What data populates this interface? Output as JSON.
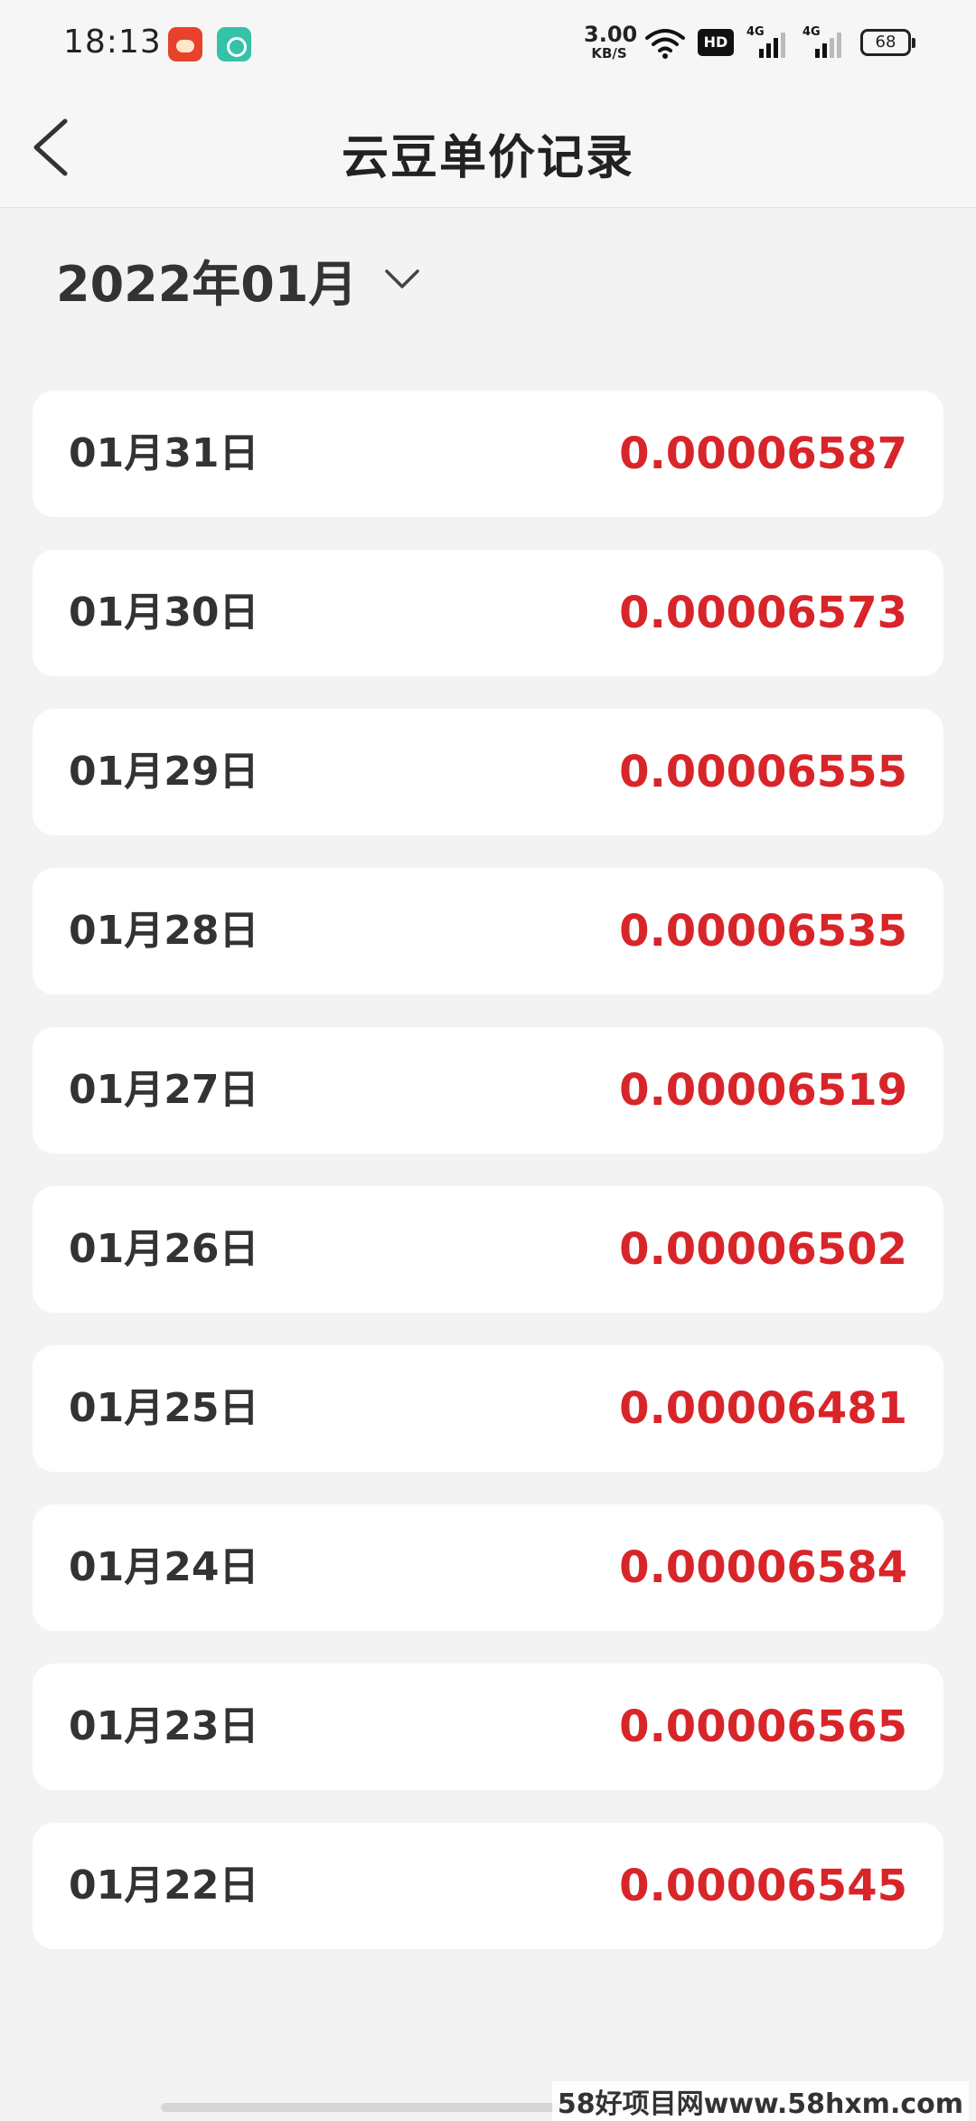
{
  "status_bar": {
    "time": "18:13",
    "net_speed_value": "3.00",
    "net_speed_unit": "KB/S",
    "hd_label": "HD",
    "signal_1_label": "4G",
    "signal_2_label": "4G",
    "battery": "68"
  },
  "header": {
    "title": "云豆单价记录"
  },
  "month_selector": {
    "label": "2022年01月"
  },
  "records": [
    {
      "date": "01月31日",
      "price": "0.00006587"
    },
    {
      "date": "01月30日",
      "price": "0.00006573"
    },
    {
      "date": "01月29日",
      "price": "0.00006555"
    },
    {
      "date": "01月28日",
      "price": "0.00006535"
    },
    {
      "date": "01月27日",
      "price": "0.00006519"
    },
    {
      "date": "01月26日",
      "price": "0.00006502"
    },
    {
      "date": "01月25日",
      "price": "0.00006481"
    },
    {
      "date": "01月24日",
      "price": "0.00006584"
    },
    {
      "date": "01月23日",
      "price": "0.00006565"
    },
    {
      "date": "01月22日",
      "price": "0.00006545"
    }
  ],
  "watermark": "58好项目网www.58hxm.com",
  "colors": {
    "price": "#d8252a",
    "background": "#f3f3f3",
    "card": "#ffffff"
  }
}
